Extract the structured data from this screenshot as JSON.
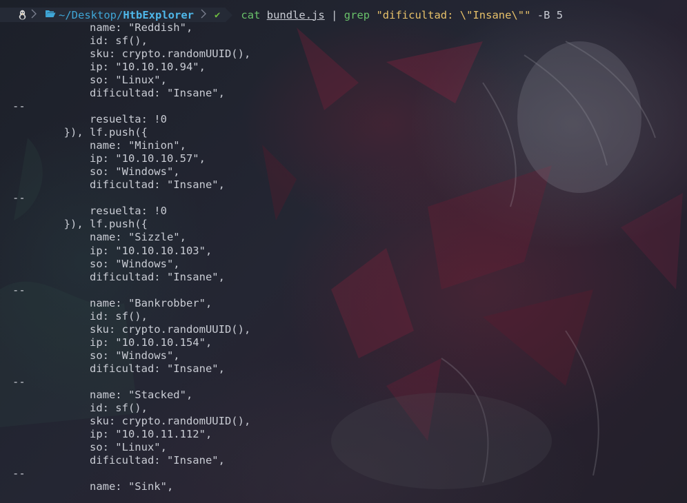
{
  "prompt": {
    "os_icon": "linux-tux-icon",
    "folder_icon": "folder-open-icon",
    "dir_home": "~/Desktop/",
    "dir_current": "HtbExplorer",
    "status_icon": "check-icon",
    "status_glyph": "✔",
    "command": {
      "name": "cat",
      "file": "bundle.js",
      "pipe": "|",
      "grep": "grep",
      "pattern_part1": "\"dificultad: \\\"Insane\\\"\"",
      "flag": "-B 5"
    }
  },
  "output_lines": [
    "            name: \"Reddish\",",
    "            id: sf(),",
    "            sku: crypto.randomUUID(),",
    "            ip: \"10.10.10.94\",",
    "            so: \"Linux\",",
    "            dificultad: \"Insane\",",
    "--",
    "            resuelta: !0",
    "        }), lf.push({",
    "            name: \"Minion\",",
    "            ip: \"10.10.10.57\",",
    "            so: \"Windows\",",
    "            dificultad: \"Insane\",",
    "--",
    "            resuelta: !0",
    "        }), lf.push({",
    "            name: \"Sizzle\",",
    "            ip: \"10.10.10.103\",",
    "            so: \"Windows\",",
    "            dificultad: \"Insane\",",
    "--",
    "            name: \"Bankrobber\",",
    "            id: sf(),",
    "            sku: crypto.randomUUID(),",
    "            ip: \"10.10.10.154\",",
    "            so: \"Windows\",",
    "            dificultad: \"Insane\",",
    "--",
    "            name: \"Stacked\",",
    "            id: sf(),",
    "            sku: crypto.randomUUID(),",
    "            ip: \"10.10.11.112\",",
    "            so: \"Linux\",",
    "            dificultad: \"Insane\",",
    "--",
    "            name: \"Sink\","
  ],
  "colors": {
    "background": "#1f2330",
    "text": "#c9ccd4",
    "command": "#69c06a",
    "string": "#e6c069",
    "directory": "#3fa6d6",
    "ok": "#6dbb3f"
  }
}
